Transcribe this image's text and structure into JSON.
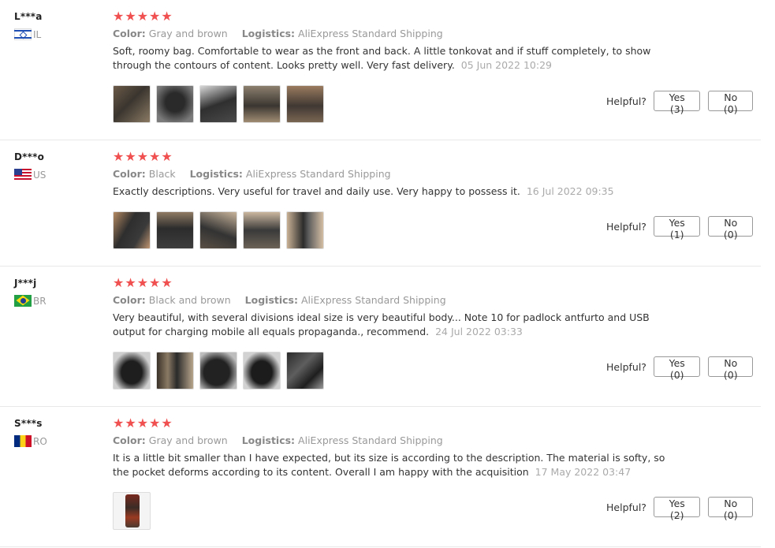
{
  "labels": {
    "color": "Color:",
    "logistics": "Logistics:",
    "helpful": "Helpful?"
  },
  "reviews": [
    {
      "user": "L***a",
      "country": "IL",
      "stars": "★★★★★",
      "color": "Gray and brown",
      "logistics": "AliExpress Standard Shipping",
      "text": "Soft, roomy bag. Comfortable to wear as the front and back. A little tonkovat and if stuff completely, to show through the contours of content. Looks pretty well. Very fast delivery.",
      "date": "05 Jun 2022 10:29",
      "yes": "Yes (3)",
      "no": "No (0)"
    },
    {
      "user": "D***o",
      "country": "US",
      "stars": "★★★★★",
      "color": "Black",
      "logistics": "AliExpress Standard Shipping",
      "text": "Exactly descriptions. Very useful for travel and daily use. Very happy to possess it.",
      "date": "16 Jul 2022 09:35",
      "yes": "Yes (1)",
      "no": "No (0)"
    },
    {
      "user": "J***j",
      "country": "BR",
      "stars": "★★★★★",
      "color": "Black and brown",
      "logistics": "AliExpress Standard Shipping",
      "text": "Very beautiful, with several divisions ideal size is very beautiful body... Note 10 for padlock antfurto and USB output for charging mobile all equals propaganda., recommend.",
      "date": "24 Jul 2022 03:33",
      "yes": "Yes (0)",
      "no": "No (0)"
    },
    {
      "user": "S***s",
      "country": "RO",
      "stars": "★★★★★",
      "color": "Gray and brown",
      "logistics": "AliExpress Standard Shipping",
      "text": "It is a little bit smaller than I have expected, but its size is according to the description. The material is softy, so the pocket deforms according to its content. Overall I am happy with the acquisition",
      "date": "17 May 2022 03:47",
      "yes": "Yes (2)",
      "no": "No (0)"
    }
  ]
}
